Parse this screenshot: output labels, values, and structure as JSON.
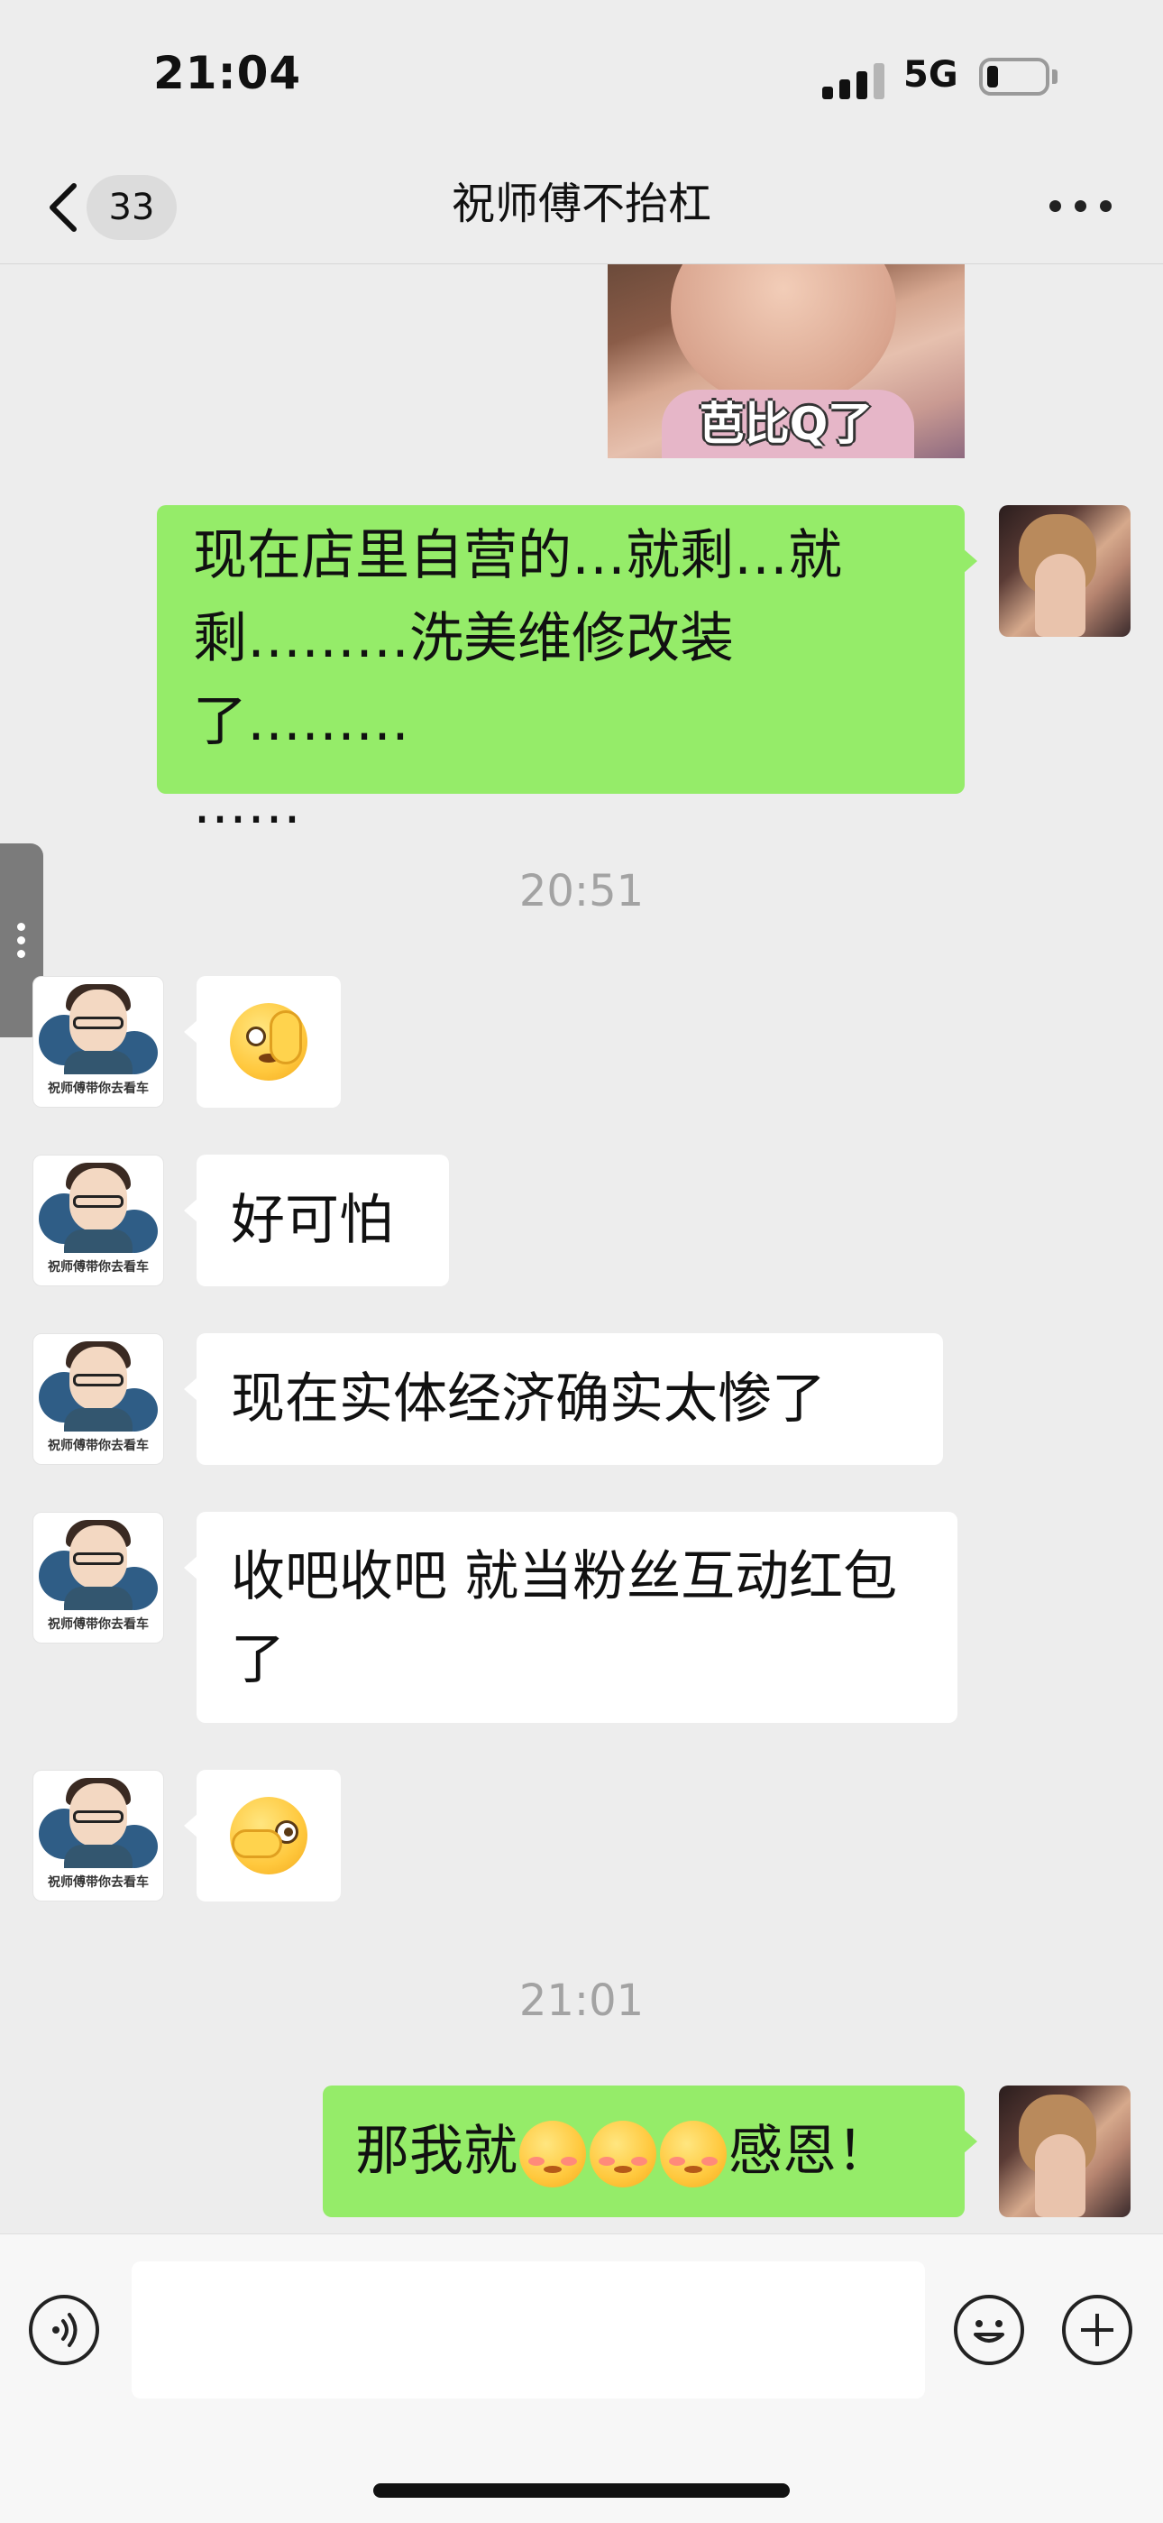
{
  "status_bar": {
    "time": "21:04",
    "network": "5G"
  },
  "header": {
    "unread_count": "33",
    "title": "祝师傅不抬杠"
  },
  "sticker": {
    "caption": "芭比Q了"
  },
  "messages": {
    "m1": {
      "text": "现在店里自营的…就剩…就剩………洗美维修改装了………",
      "text_tail": "……"
    },
    "ts1": "20:51",
    "m3": "好可怕",
    "m4": "现在实体经济确实太惨了",
    "m5": "收吧收吧 就当粉丝互动红包了",
    "ts2": "21:01",
    "m7": {
      "prefix": "那我就",
      "suffix": "感恩！"
    }
  },
  "contact_avatar": {
    "label": "祝师傅带你去看车"
  },
  "icons": {
    "back": "chevron-left-icon",
    "more": "more-dots-icon",
    "voice": "voice-icon",
    "emoji": "emoji-icon",
    "add": "add-icon",
    "msg2_emoji": "salute-emoji",
    "msg6_emoji": "facepalm-peek-emoji",
    "msg7_emoji": "shy-blush-emoji"
  },
  "colors": {
    "background": "#ededed",
    "my_bubble": "#95ec69",
    "their_bubble": "#ffffff"
  }
}
